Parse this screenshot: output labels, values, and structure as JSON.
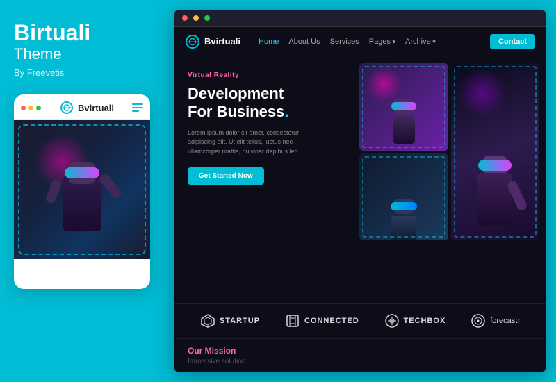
{
  "left": {
    "brand_name": "Birtuali",
    "brand_sub": "Theme",
    "by_line": "By Freevetis",
    "mobile_logo": "Bvirtuali",
    "dots": [
      "red",
      "yellow",
      "green"
    ]
  },
  "right": {
    "browser_dots": [
      "red",
      "yellow",
      "green"
    ],
    "nav": {
      "logo": "Bvirtuali",
      "links": [
        {
          "label": "Home",
          "active": true
        },
        {
          "label": "About Us",
          "active": false
        },
        {
          "label": "Services",
          "active": false
        },
        {
          "label": "Pages",
          "active": false,
          "has_arrow": true
        },
        {
          "label": "Archive",
          "active": false,
          "has_arrow": true
        }
      ],
      "contact_btn": "Contact"
    },
    "hero": {
      "tag": "Virtual Reality",
      "title_line1": "Development",
      "title_line2": "For Business",
      "title_dot": ".",
      "description": "Lorem ipsum dolor sit amet, consectetur adipiscing elit. Ut elit tellus, luctus nec ullamcorper mattis, pulvinar dapibus leo.",
      "cta_label": "Get Started Now"
    },
    "brands": [
      {
        "name": "STARTUP"
      },
      {
        "name": "CONNECTED"
      },
      {
        "name": "TECHBOX"
      },
      {
        "name": "forecastr"
      }
    ],
    "mission": {
      "title": "Our Mission",
      "subtitle": "Immersive solution..."
    }
  }
}
